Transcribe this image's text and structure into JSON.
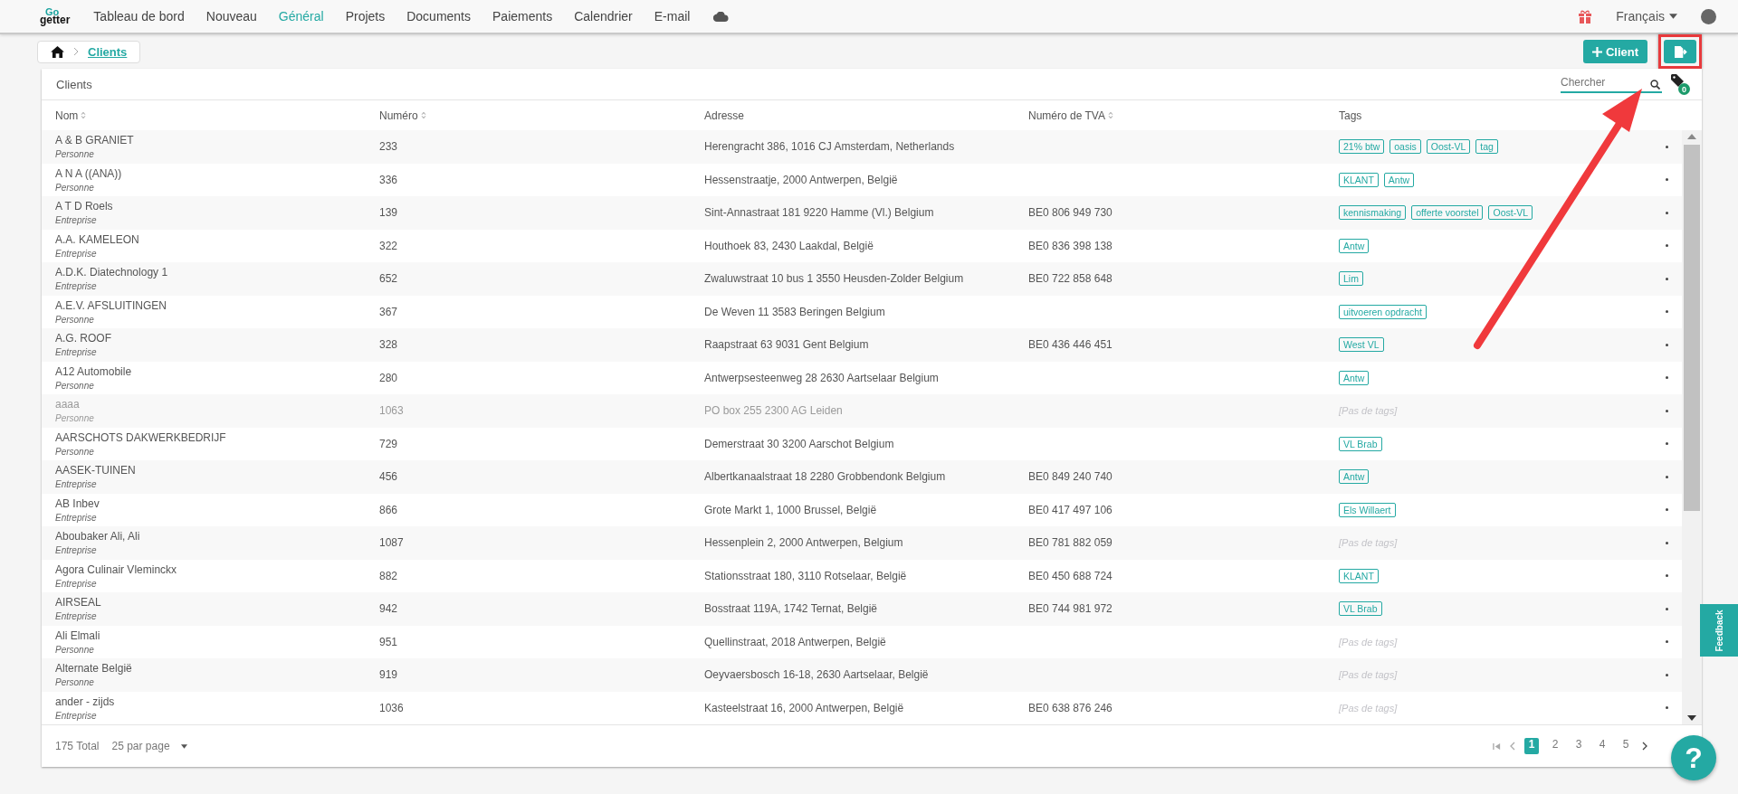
{
  "nav": {
    "logo_top": "Go",
    "logo_bottom": "getter",
    "items": [
      {
        "label": "Tableau de bord",
        "selected": false
      },
      {
        "label": "Nouveau",
        "selected": false
      },
      {
        "label": "Général",
        "selected": true
      },
      {
        "label": "Projets",
        "selected": false
      },
      {
        "label": "Documents",
        "selected": false
      },
      {
        "label": "Paiements",
        "selected": false
      },
      {
        "label": "Calendrier",
        "selected": false
      },
      {
        "label": "E-mail",
        "selected": false
      }
    ],
    "language": "Français"
  },
  "breadcrumb": {
    "current": "Clients"
  },
  "actions": {
    "add_label": "Client",
    "export_highlighted": true
  },
  "card": {
    "title": "Clients",
    "search_placeholder": "Chercher",
    "tag_filter_count": "0"
  },
  "columns": [
    {
      "label": "Nom",
      "sortable": true
    },
    {
      "label": "Numéro",
      "sortable": true
    },
    {
      "label": "Adresse",
      "sortable": false
    },
    {
      "label": "Numéro de TVA",
      "sortable": true
    },
    {
      "label": "Tags",
      "sortable": false
    }
  ],
  "rows": [
    {
      "name": "A & B GRANIET",
      "type": "Personne",
      "number": "233",
      "address": "Herengracht 386, 1016 CJ Amsterdam, Netherlands",
      "tags": [
        "21% btw",
        "oasis",
        "Oost-VL",
        "tag"
      ],
      "disabled": false
    },
    {
      "name": "A N A ((ANA))",
      "type": "Personne",
      "number": "336",
      "address": "Hessenstraatje, 2000 Antwerpen, België",
      "tags": [
        "KLANT",
        "Antw"
      ],
      "disabled": false
    },
    {
      "name": "A T D Roels",
      "type": "Entreprise",
      "number": "139",
      "address": "Sint-Annastraat 181 9220 Hamme (Vl.) Belgium",
      "vat": "BE0 806 949 730",
      "tags": [
        "kennismaking",
        "offerte voorstel",
        "Oost-VL"
      ],
      "disabled": false
    },
    {
      "name": "A.A. KAMELEON",
      "type": "Entreprise",
      "number": "322",
      "address": "Houthoek 83, 2430 Laakdal, België",
      "vat": "BE0 836 398 138",
      "tags": [
        "Antw"
      ],
      "disabled": false
    },
    {
      "name": "A.D.K. Diatechnology 1",
      "type": "Entreprise",
      "number": "652",
      "address": "Zwaluwstraat 10 bus 1 3550 Heusden-Zolder Belgium",
      "vat": "BE0 722 858 648",
      "tags": [
        "Lim"
      ],
      "disabled": false
    },
    {
      "name": "A.E.V. AFSLUITINGEN",
      "type": "Personne",
      "number": "367",
      "address": "De Weven 11 3583 Beringen Belgium",
      "tags": [
        "uitvoeren opdracht"
      ],
      "disabled": false
    },
    {
      "name": "A.G. ROOF",
      "type": "Entreprise",
      "number": "328",
      "address": "Raapstraat 63 9031 Gent Belgium",
      "vat": "BE0 436 446 451",
      "tags": [
        "West VL"
      ],
      "disabled": false
    },
    {
      "name": "A12 Automobile",
      "type": "Personne",
      "number": "280",
      "address": "Antwerpsesteenweg 28 2630 Aartselaar Belgium",
      "tags": [
        "Antw"
      ],
      "disabled": false
    },
    {
      "name": "aaaa",
      "type": "Personne",
      "number": "1063",
      "address": "PO box 255 2300 AG Leiden",
      "no_tags": "[Pas de tags]",
      "disabled": true
    },
    {
      "name": "AARSCHOTS DAKWERKBEDRIJF",
      "type": "Personne",
      "number": "729",
      "address": "Demerstraat 30 3200 Aarschot Belgium",
      "tags": [
        "VL Brab"
      ],
      "disabled": false
    },
    {
      "name": "AASEK-TUINEN",
      "type": "Entreprise",
      "number": "456",
      "address": "Albertkanaalstraat 18 2280 Grobbendonk Belgium",
      "vat": "BE0 849 240 740",
      "tags": [
        "Antw"
      ],
      "disabled": false
    },
    {
      "name": "AB Inbev",
      "type": "Entreprise",
      "number": "866",
      "address": "Grote Markt 1, 1000 Brussel, België",
      "vat": "BE0 417 497 106",
      "tags": [
        "Els Willaert"
      ],
      "disabled": false
    },
    {
      "name": "Aboubaker Ali, Ali",
      "type": "Entreprise",
      "number": "1087",
      "address": "Hessenplein 2, 2000 Antwerpen, Belgium",
      "vat": "BE0 781 882 059",
      "no_tags": "[Pas de tags]",
      "disabled": false
    },
    {
      "name": "Agora Culinair Vleminckx",
      "type": "Entreprise",
      "number": "882",
      "address": "Stationsstraat 180, 3110 Rotselaar, België",
      "vat": "BE0 450 688 724",
      "tags": [
        "KLANT"
      ],
      "disabled": false
    },
    {
      "name": "AIRSEAL",
      "type": "Entreprise",
      "number": "942",
      "address": "Bosstraat 119A, 1742 Ternat, België",
      "vat": "BE0 744 981 972",
      "tags": [
        "VL Brab"
      ],
      "disabled": false
    },
    {
      "name": "Ali Elmali",
      "type": "Personne",
      "number": "951",
      "address": "Quellinstraat, 2018 Antwerpen, België",
      "no_tags": "[Pas de tags]",
      "disabled": false
    },
    {
      "name": "Alternate België",
      "type": "Personne",
      "number": "919",
      "address": "Oeyvaersbosch 16-18, 2630 Aartselaar, België",
      "no_tags": "[Pas de tags]",
      "disabled": false
    },
    {
      "name": "ander - zijds",
      "type": "Entreprise",
      "number": "1036",
      "address": "Kasteelstraat 16, 2000 Antwerpen, België",
      "vat": "BE0 638 876 246",
      "no_tags": "[Pas de tags]",
      "disabled": false
    }
  ],
  "footer": {
    "total": "175 Total",
    "per_page": "25 par page",
    "pages": [
      {
        "label": "1",
        "selected": true
      },
      {
        "label": "2",
        "selected": false
      },
      {
        "label": "3",
        "selected": false
      },
      {
        "label": "4",
        "selected": false
      },
      {
        "label": "5",
        "selected": false
      }
    ]
  },
  "feedback": "Feedback",
  "help": "?"
}
